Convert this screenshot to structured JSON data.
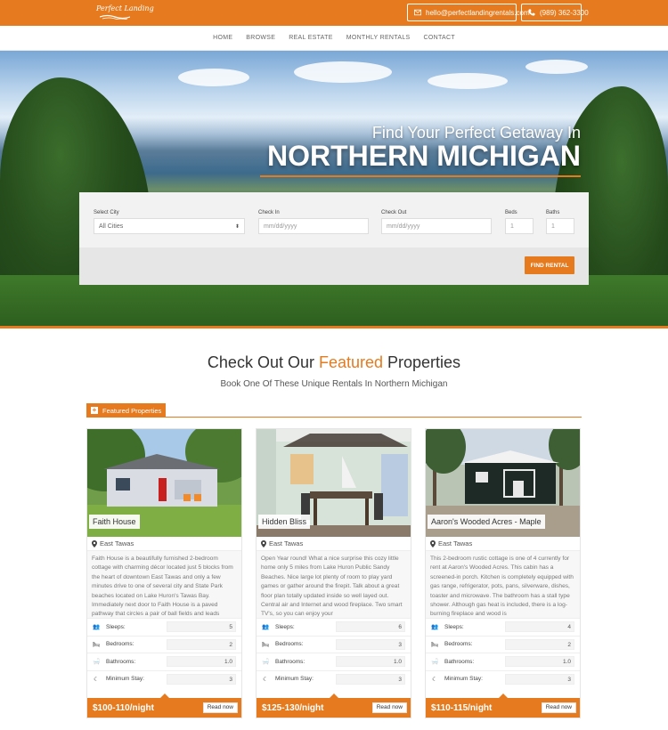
{
  "topbar": {
    "logo_text": "Perfect Landing",
    "email": "hello@perfectlandingrentals.com",
    "phone": "(989) 362-3300",
    "accent_color": "#e57b1e"
  },
  "nav": {
    "items": [
      {
        "label": "HOME"
      },
      {
        "label": "BROWSE"
      },
      {
        "label": "REAL ESTATE"
      },
      {
        "label": "MONTHLY RENTALS"
      },
      {
        "label": "CONTACT"
      }
    ]
  },
  "hero": {
    "subtitle": "Find Your Perfect Getaway In",
    "title": "NORTHERN MICHIGAN"
  },
  "search": {
    "city_label": "Select City",
    "city_value": "All Cities",
    "checkin_label": "Check In",
    "checkin_placeholder": "mm/dd/yyyy",
    "checkout_label": "Check Out",
    "checkout_placeholder": "mm/dd/yyyy",
    "beds_label": "Beds",
    "beds_value": "1",
    "baths_label": "Baths",
    "baths_value": "1",
    "button": "FIND RENTAL"
  },
  "featured": {
    "title_pre": "Check Out Our ",
    "title_accent": "Featured",
    "title_post": " Properties",
    "subtitle": "Book One Of These Unique Rentals In Northern Michigan",
    "tab_label": "Featured Properties",
    "spec_labels": {
      "sleeps": "Sleeps:",
      "bedrooms": "Bedrooms:",
      "bathrooms": "Bathrooms:",
      "min_stay": "Minimum Stay:"
    },
    "read_now": "Read now",
    "cards": [
      {
        "name": "Faith House",
        "location": "East Tawas",
        "description": "Faith House is a beautifully furnished 2-bedroom cottage with charming décor located just 5 blocks from the heart of downtown East Tawas and only a few minutes drive to one of several city and State Park beaches located on Lake Huron's Tawas Bay. Immediately next door to Faith House is a paved pathway that circles a pair of ball fields and leads",
        "sleeps": "5",
        "bedrooms": "2",
        "bathrooms": "1.0",
        "min_stay": "3",
        "price": "$100-110/night"
      },
      {
        "name": "Hidden Bliss",
        "location": "East Tawas",
        "description": "Open Year round! What a nice surprise this cozy little home only 5 miles from Lake Huron Public Sandy Beaches.  Nice large lot plenty of room to play yard games or gather around the firepit.  Talk about a great floor plan totally updated inside so well layed out. Central air and Internet and wood fireplace. Two smart TV's, so you can enjoy your",
        "sleeps": "6",
        "bedrooms": "3",
        "bathrooms": "1.0",
        "min_stay": "3",
        "price": "$125-130/night"
      },
      {
        "name": "Aaron's Wooded Acres - Maple",
        "location": "East Tawas",
        "description": "This 2-bedroom rustic cottage is one of 4 currently for rent at Aaron's Wooded Acres. This cabin has a screened-in porch. Kitchen is completely equipped with gas range, refrigerator, pots, pans, silverware, dishes, toaster and microwave. The bathroom has a stall type shower. Although gas heat is included, there is a log-burning fireplace and wood is",
        "sleeps": "4",
        "bedrooms": "2",
        "bathrooms": "1.0",
        "min_stay": "3",
        "price": "$110-115/night"
      }
    ]
  }
}
